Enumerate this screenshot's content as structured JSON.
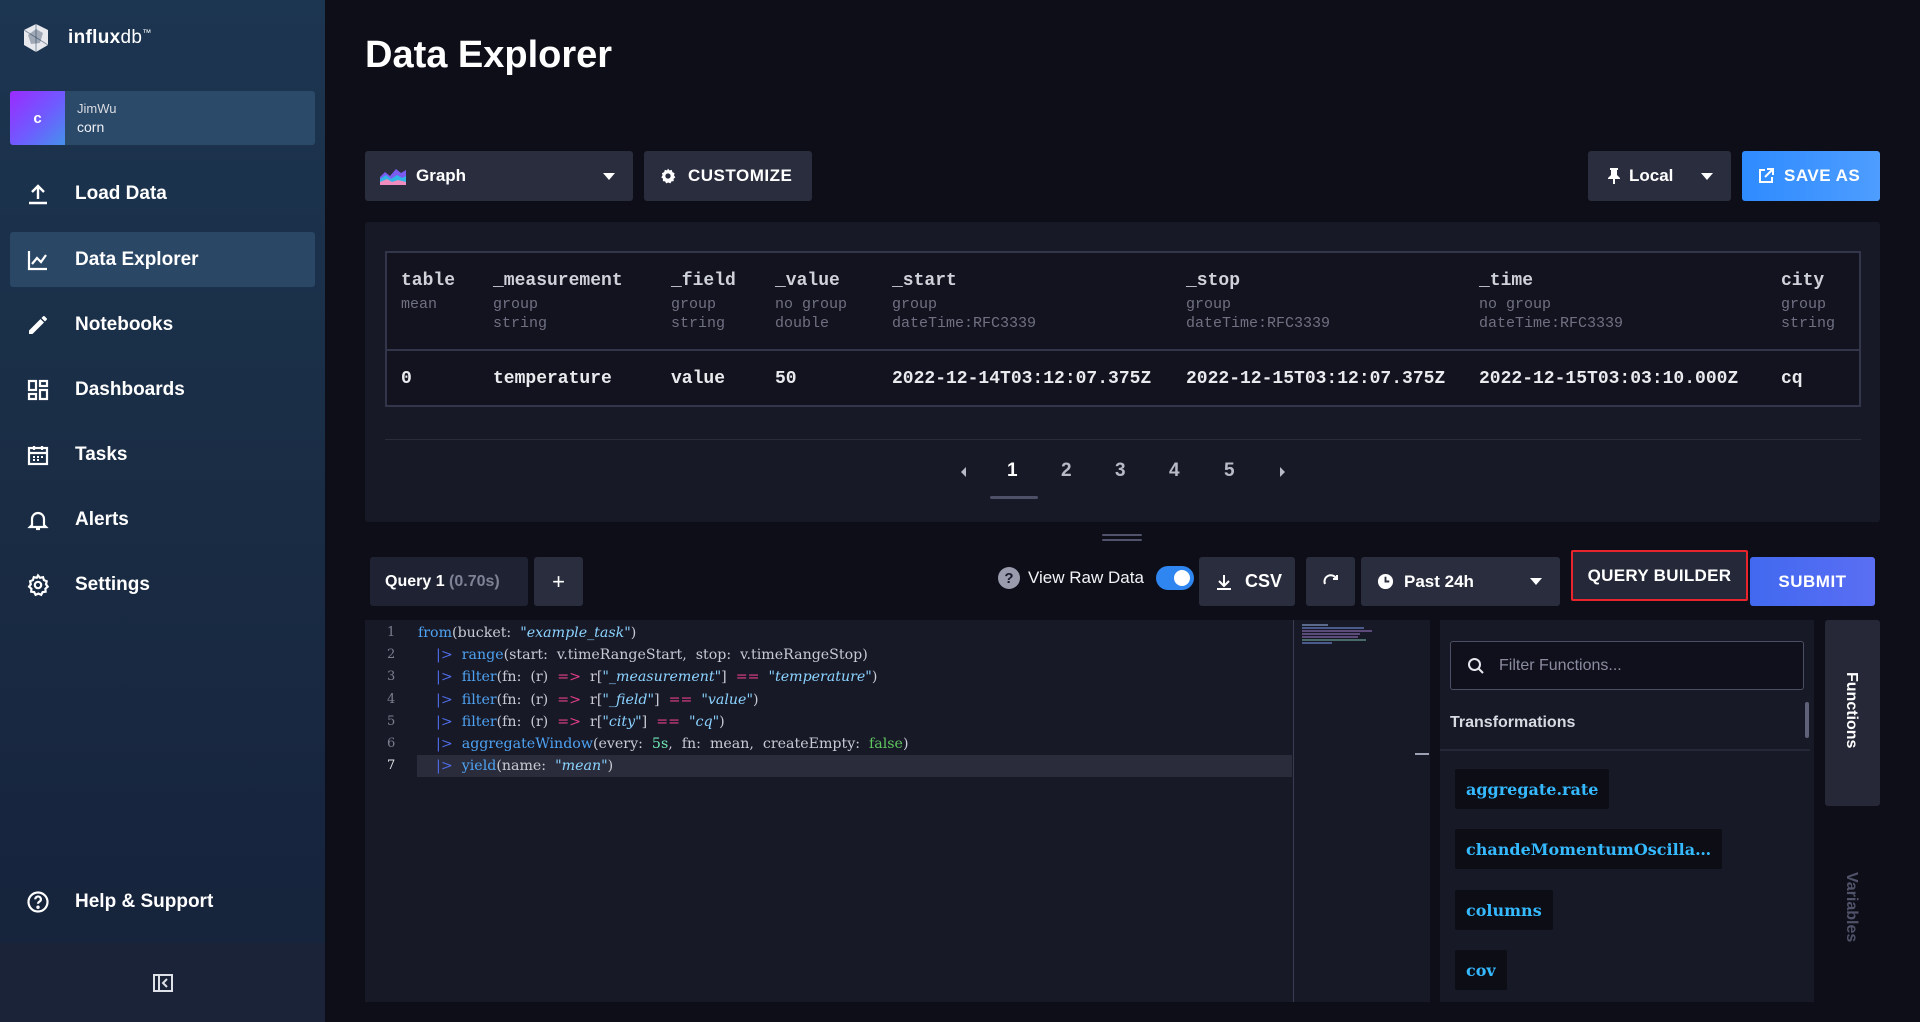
{
  "brand": {
    "name_bold": "influx",
    "name_light": "db",
    "trademark": "™"
  },
  "org": {
    "avatar_letter": "c",
    "user": "JimWu",
    "name": "corn"
  },
  "nav": {
    "items": [
      {
        "label": "Load Data",
        "icon": "upload-icon"
      },
      {
        "label": "Data Explorer",
        "icon": "graph-icon"
      },
      {
        "label": "Notebooks",
        "icon": "pencil-icon"
      },
      {
        "label": "Dashboards",
        "icon": "dashboard-icon"
      },
      {
        "label": "Tasks",
        "icon": "calendar-icon"
      },
      {
        "label": "Alerts",
        "icon": "bell-icon"
      },
      {
        "label": "Settings",
        "icon": "gear-icon"
      }
    ],
    "help": "Help & Support"
  },
  "header": {
    "title": "Data Explorer"
  },
  "toolbar": {
    "vis_type": "Graph",
    "customize": "CUSTOMIZE",
    "timezone": "Local",
    "save_as": "SAVE AS"
  },
  "table": {
    "columns": [
      {
        "name": "table",
        "group": "mean",
        "type": ""
      },
      {
        "name": "_measurement",
        "group": "group",
        "type": "string"
      },
      {
        "name": "_field",
        "group": "group",
        "type": "string"
      },
      {
        "name": "_value",
        "group": "no group",
        "type": "double"
      },
      {
        "name": "_start",
        "group": "group",
        "type": "dateTime:RFC3339"
      },
      {
        "name": "_stop",
        "group": "group",
        "type": "dateTime:RFC3339"
      },
      {
        "name": "_time",
        "group": "no group",
        "type": "dateTime:RFC3339"
      },
      {
        "name": "city",
        "group": "group",
        "type": "string"
      }
    ],
    "rows": [
      [
        "0",
        "temperature",
        "value",
        "50",
        "2022-12-14T03:12:07.375Z",
        "2022-12-15T03:12:07.375Z",
        "2022-12-15T03:03:10.000Z",
        "cq"
      ]
    ]
  },
  "pagination": {
    "pages": [
      "1",
      "2",
      "3",
      "4",
      "5"
    ],
    "current": "1"
  },
  "query": {
    "tab_label": "Query 1",
    "tab_time": "(0.70s)",
    "add_label": "+",
    "raw_label": "View Raw Data",
    "help_glyph": "?",
    "csv": "CSV",
    "time_range": "Past 24h",
    "query_builder": "QUERY BUILDER",
    "submit": "SUBMIT"
  },
  "editor": {
    "line_numbers": [
      "1",
      "2",
      "3",
      "4",
      "5",
      "6",
      "7"
    ],
    "lines": [
      [
        {
          "t": "from",
          "c": "k-fn"
        },
        {
          "t": "(bucket:  ",
          "c": "k-id"
        },
        {
          "t": "\"example_task\"",
          "c": "k-str"
        },
        {
          "t": ")",
          "c": "k-id"
        }
      ],
      [
        {
          "t": "    ",
          "c": "k-id"
        },
        {
          "t": "|>",
          "c": "k-pipe"
        },
        {
          "t": "  ",
          "c": "k-id"
        },
        {
          "t": "range",
          "c": "k-fn"
        },
        {
          "t": "(start:  v.timeRangeStart,  stop:  v.timeRangeStop)",
          "c": "k-id"
        }
      ],
      [
        {
          "t": "    ",
          "c": "k-id"
        },
        {
          "t": "|>",
          "c": "k-pipe"
        },
        {
          "t": "  ",
          "c": "k-id"
        },
        {
          "t": "filter",
          "c": "k-fn"
        },
        {
          "t": "(fn:  (r)  ",
          "c": "k-id"
        },
        {
          "t": "=>",
          "c": "k-op"
        },
        {
          "t": "  r[",
          "c": "k-id"
        },
        {
          "t": "\"_measurement\"",
          "c": "k-str"
        },
        {
          "t": "]  ",
          "c": "k-id"
        },
        {
          "t": "==",
          "c": "k-op"
        },
        {
          "t": "  ",
          "c": "k-id"
        },
        {
          "t": "\"temperature\"",
          "c": "k-str"
        },
        {
          "t": ")",
          "c": "k-id"
        }
      ],
      [
        {
          "t": "    ",
          "c": "k-id"
        },
        {
          "t": "|>",
          "c": "k-pipe"
        },
        {
          "t": "  ",
          "c": "k-id"
        },
        {
          "t": "filter",
          "c": "k-fn"
        },
        {
          "t": "(fn:  (r)  ",
          "c": "k-id"
        },
        {
          "t": "=>",
          "c": "k-op"
        },
        {
          "t": "  r[",
          "c": "k-id"
        },
        {
          "t": "\"_field\"",
          "c": "k-str"
        },
        {
          "t": "]  ",
          "c": "k-id"
        },
        {
          "t": "==",
          "c": "k-op"
        },
        {
          "t": "  ",
          "c": "k-id"
        },
        {
          "t": "\"value\"",
          "c": "k-str"
        },
        {
          "t": ")",
          "c": "k-id"
        }
      ],
      [
        {
          "t": "    ",
          "c": "k-id"
        },
        {
          "t": "|>",
          "c": "k-pipe"
        },
        {
          "t": "  ",
          "c": "k-id"
        },
        {
          "t": "filter",
          "c": "k-fn"
        },
        {
          "t": "(fn:  (r)  ",
          "c": "k-id"
        },
        {
          "t": "=>",
          "c": "k-op"
        },
        {
          "t": "  r[",
          "c": "k-id"
        },
        {
          "t": "\"city\"",
          "c": "k-str"
        },
        {
          "t": "]  ",
          "c": "k-id"
        },
        {
          "t": "==",
          "c": "k-op"
        },
        {
          "t": "  ",
          "c": "k-id"
        },
        {
          "t": "\"cq\"",
          "c": "k-str"
        },
        {
          "t": ")",
          "c": "k-id"
        }
      ],
      [
        {
          "t": "    ",
          "c": "k-id"
        },
        {
          "t": "|>",
          "c": "k-pipe"
        },
        {
          "t": "  ",
          "c": "k-id"
        },
        {
          "t": "aggregateWindow",
          "c": "k-fn"
        },
        {
          "t": "(every:  ",
          "c": "k-id"
        },
        {
          "t": "5s",
          "c": "k-num"
        },
        {
          "t": ",  fn:  mean,  createEmpty:  ",
          "c": "k-id"
        },
        {
          "t": "false",
          "c": "k-bool"
        },
        {
          "t": ")",
          "c": "k-id"
        }
      ],
      [
        {
          "t": "    ",
          "c": "k-id"
        },
        {
          "t": "|>",
          "c": "k-pipe"
        },
        {
          "t": "  ",
          "c": "k-id"
        },
        {
          "t": "yield",
          "c": "k-fn"
        },
        {
          "t": "(name:  ",
          "c": "k-id"
        },
        {
          "t": "\"mean\"",
          "c": "k-str"
        },
        {
          "t": ")",
          "c": "k-id"
        }
      ]
    ]
  },
  "functions": {
    "search_placeholder": "Filter Functions...",
    "group_title": "Transformations",
    "items": [
      "aggregate.rate",
      "chandeMomentumOscilla…",
      "columns",
      "cov"
    ]
  },
  "side_tabs": {
    "functions": "Functions",
    "variables": "Variables"
  },
  "colors": {
    "accent_blue": "#2e8bff",
    "submit_blue": "#4169f0",
    "highlight_red": "#e8252c",
    "sidebar_bg": "#1c3551"
  }
}
